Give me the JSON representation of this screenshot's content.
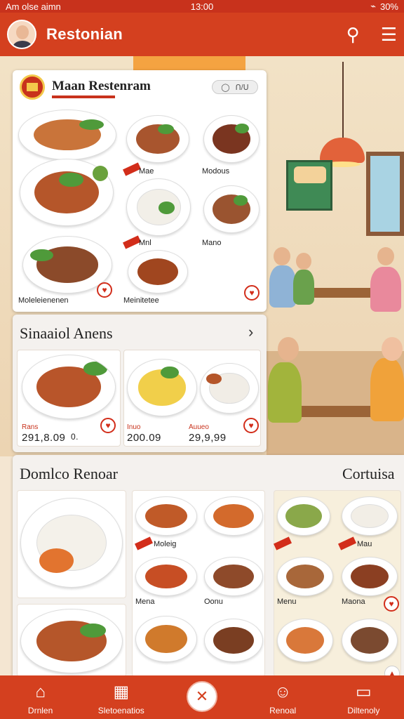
{
  "status_bar": {
    "carrier": "Am olse aimn",
    "time": "13:00",
    "battery": "30%"
  },
  "header": {
    "title": "Restonian",
    "search_icon": "search-icon",
    "menu_icon": "menu-icon"
  },
  "featured": {
    "name": "Maan Restenram",
    "toggle_text": "ᑎ/ᑌ",
    "items": [
      {
        "label": "Moleleienenen"
      },
      {
        "label": "Mae"
      },
      {
        "label": "Modous"
      },
      {
        "label": "Mnl"
      },
      {
        "label": "Mano"
      },
      {
        "label": "Meinitetee"
      }
    ]
  },
  "section2": {
    "title": "Sinaaiol Anens",
    "items": [
      {
        "label": "Rans",
        "price": "291,8.09",
        "extra": "0."
      },
      {
        "label": "Inuo",
        "price": "200.09"
      },
      {
        "label": "Auueo",
        "price": "29,9,99"
      }
    ]
  },
  "section3": {
    "title": "Domlco Renoar",
    "right_title": "Cortuisa",
    "items": [
      {
        "label": "Moleig"
      },
      {
        "label": "Mena"
      },
      {
        "label": "Oonu"
      },
      {
        "label": "Menu"
      },
      {
        "label": "Maona"
      },
      {
        "label": "Mau"
      }
    ]
  },
  "nav": {
    "items": [
      {
        "label": "Drnlen",
        "icon": "home-icon"
      },
      {
        "label": "Sletoenatios",
        "icon": "calendar-icon"
      },
      {
        "label": "",
        "icon": "action-icon"
      },
      {
        "label": "Renoal",
        "icon": "user-icon"
      },
      {
        "label": "Diltenoly",
        "icon": "bag-icon"
      }
    ]
  },
  "colors": {
    "primary": "#d4401f",
    "accent": "#c8321c",
    "tag": "#d22d1a"
  }
}
